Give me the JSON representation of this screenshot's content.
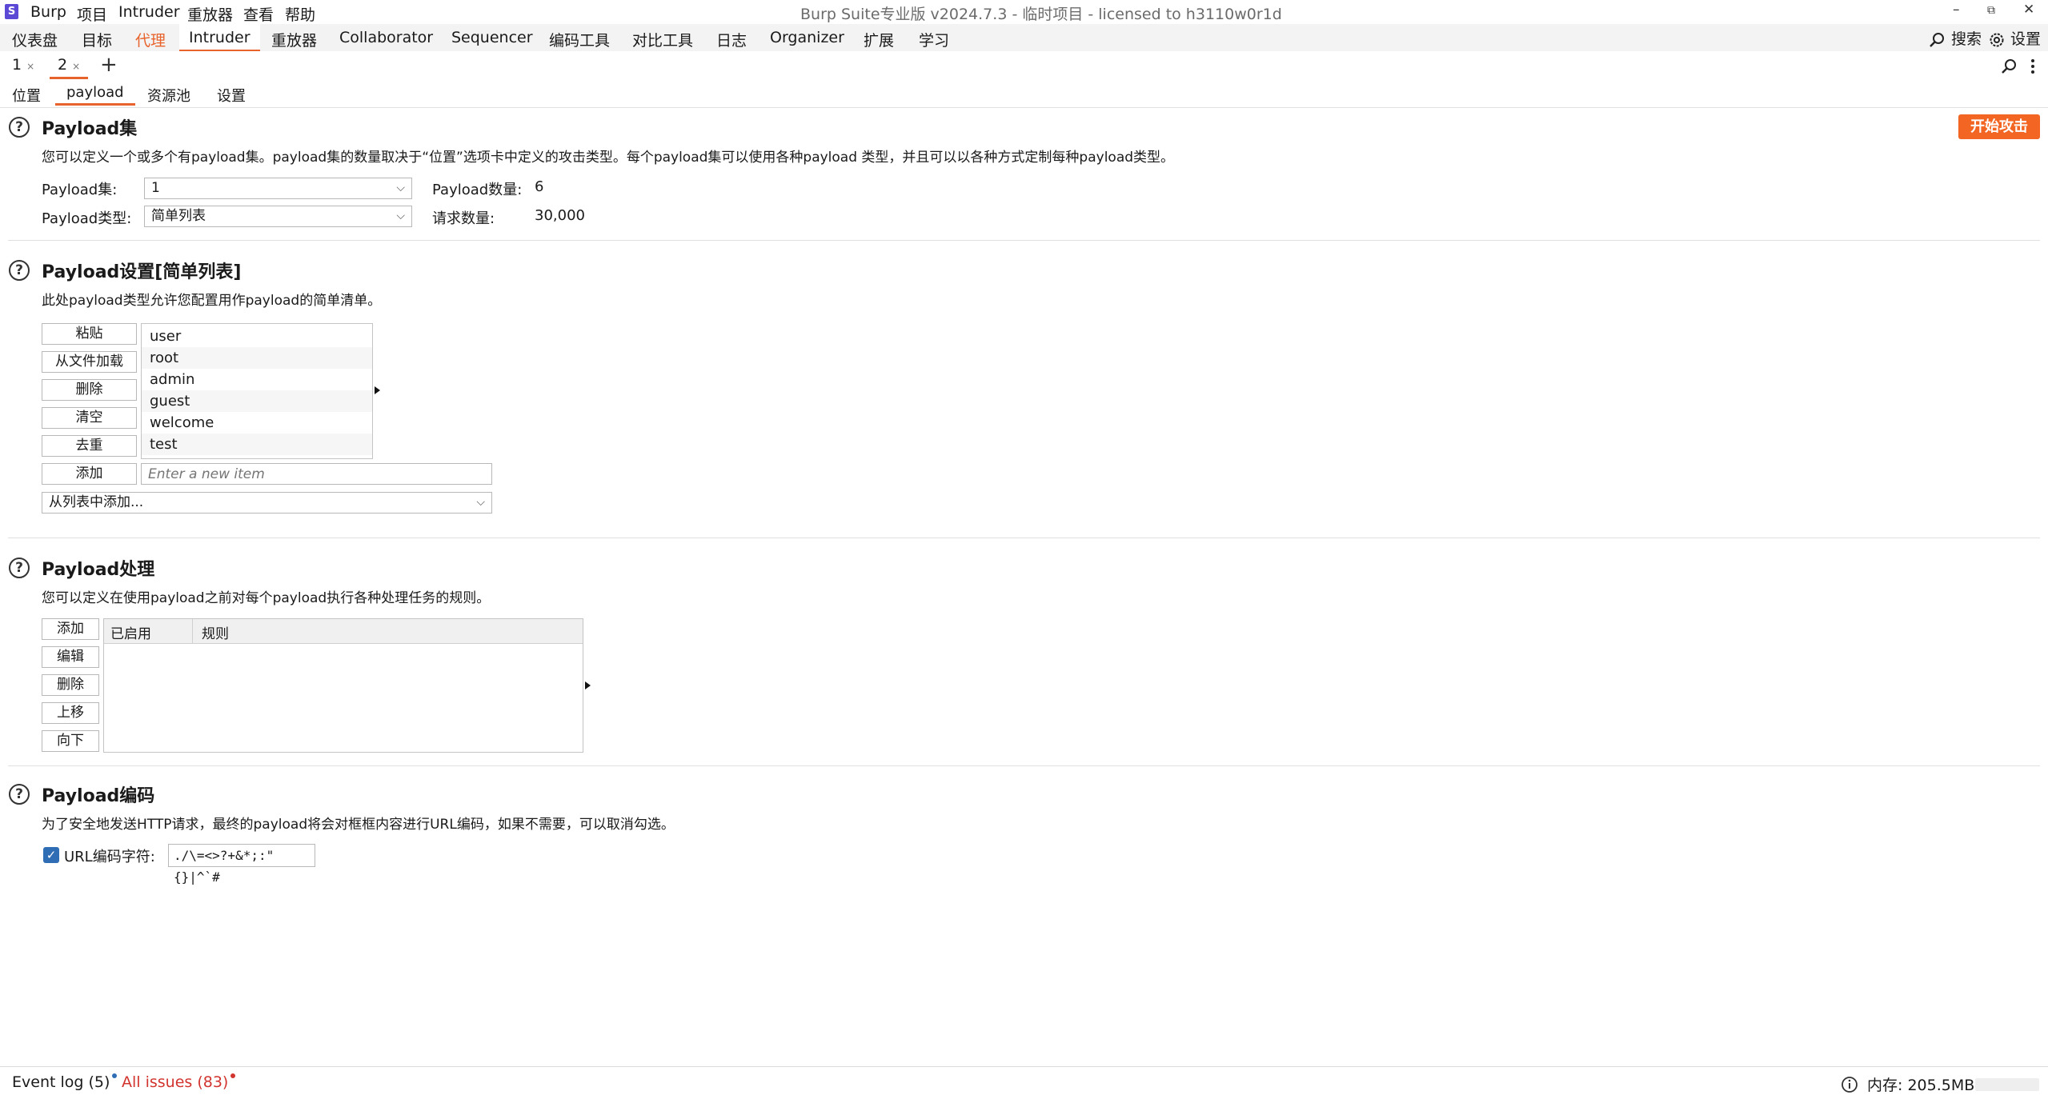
{
  "app": {
    "logo_letter": "S",
    "menu": [
      "Burp",
      "项目",
      "Intruder",
      "重放器",
      "查看",
      "帮助"
    ],
    "window_title": "Burp Suite专业版  v2024.7.3 - 临时项目 - licensed to h3110w0r1d",
    "window_controls": [
      "–",
      "⧉",
      "✕"
    ]
  },
  "tool_tabs": [
    "仪表盘",
    "目标",
    "代理",
    "Intruder",
    "重放器",
    "Collaborator",
    "Sequencer",
    "编码工具",
    "对比工具",
    "日志",
    "Organizer",
    "扩展",
    "学习"
  ],
  "tool_right": {
    "search_label": "搜索",
    "settings_label": "设置"
  },
  "attack_tabs": [
    {
      "label": "1",
      "close": "×"
    },
    {
      "label": "2",
      "close": "×"
    }
  ],
  "add_tab": "+",
  "inner_tabs": [
    "位置",
    "payload",
    "资源池",
    "设置"
  ],
  "start_attack": "开始攻击",
  "payload_sets": {
    "title": "Payload集",
    "description": "您可以定义一个或多个有payload集。payload集的数量取决于“位置”选项卡中定义的攻击类型。每个payload集可以使用各种payload 类型，并且可以以各种方式定制每种payload类型。",
    "set_label": "Payload集:",
    "set_value": "1",
    "type_label": "Payload类型:",
    "type_value": "简单列表",
    "count_label": "Payload数量:",
    "count_value": "6",
    "requests_label": "请求数量:",
    "requests_value": "30,000"
  },
  "payload_settings": {
    "title": "Payload设置[简单列表]",
    "description": "此处payload类型允许您配置用作payload的简单清单。",
    "buttons": {
      "paste": "粘贴",
      "load": "从文件加载",
      "remove": "删除",
      "clear": "清空",
      "dedupe": "去重",
      "add": "添加"
    },
    "items": [
      "user",
      "root",
      "admin",
      "guest",
      "welcome",
      "test"
    ],
    "new_item_placeholder": "Enter a new item",
    "add_from_list": "从列表中添加..."
  },
  "payload_processing": {
    "title": "Payload处理",
    "description": "您可以定义在使用payload之前对每个payload执行各种处理任务的规则。",
    "buttons": {
      "add": "添加",
      "edit": "编辑",
      "remove": "删除",
      "up": "上移",
      "down": "向下"
    },
    "columns": [
      "已启用",
      "规则"
    ]
  },
  "payload_encoding": {
    "title": "Payload编码",
    "description": "为了安全地发送HTTP请求，最终的payload将会对框框内容进行URL编码，如果不需要，可以取消勾选。",
    "checkbox_label": "URL编码字符:",
    "checked": true,
    "chars": "./\\=<>?+&*;:\"{}|^`#"
  },
  "status": {
    "event_log": "Event log (5)",
    "all_issues": "All issues (83)",
    "memory": "内存: 205.5MB"
  },
  "colors": {
    "accent": "#e8632b",
    "start_button": "#f26522",
    "checkbox": "#2f6db5"
  }
}
